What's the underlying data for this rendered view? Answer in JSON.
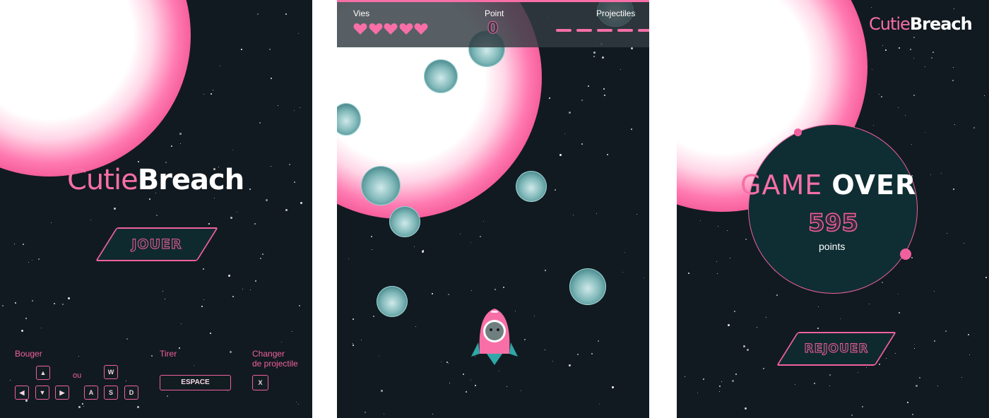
{
  "start_screen": {
    "title_part1": "Cutie",
    "title_part2": "Breach",
    "play_button": "JOUER",
    "controls": {
      "move_label": "Bouger",
      "or_label": "ou",
      "shoot_label": "Tirer",
      "switch_label_line1": "Changer",
      "switch_label_line2": "de projectile",
      "arrow_keys": [
        "▲",
        "◀",
        "▼",
        "▶"
      ],
      "wasd_keys": [
        "W",
        "A",
        "S",
        "D"
      ],
      "space_key": "ESPACE",
      "switch_key": "X"
    }
  },
  "game_screen": {
    "hud": {
      "lives_label": "Vies",
      "lives_count": 5,
      "score_label": "Point",
      "score_value": "0",
      "projectiles_label": "Projectiles",
      "projectile_slots": 5
    },
    "enemy_count": 9
  },
  "gameover_screen": {
    "logo_part1": "Cutie",
    "logo_part2": "Breach",
    "heading_part1": "GAME",
    "heading_part2": "OVER",
    "score": "595",
    "score_unit": "points",
    "replay_button": "REJOUER"
  },
  "colors": {
    "accent_pink": "#f76fa6",
    "background": "#111a20",
    "teal": "#2fa8a8"
  }
}
